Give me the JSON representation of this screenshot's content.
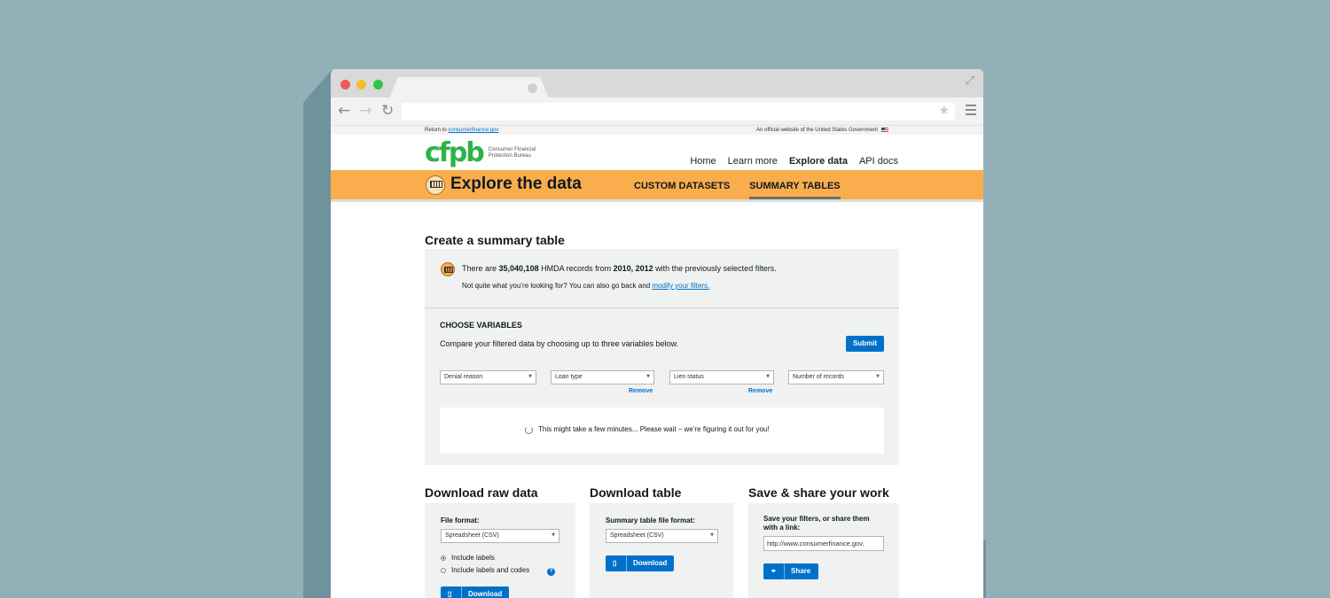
{
  "site": {
    "return_text": "Return to ",
    "return_link": "consumerfinance.gov",
    "official_text": "An official website of the United States Government",
    "logo_mark": "cfpb",
    "logo_text": "Consumer Financial Protection Bureau"
  },
  "nav": {
    "items": [
      {
        "label": "Home"
      },
      {
        "label": "Learn more"
      },
      {
        "label": "Explore data"
      },
      {
        "label": "API docs"
      }
    ]
  },
  "explore": {
    "title": "Explore the data",
    "tabs": [
      {
        "label": "CUSTOM DATASETS"
      },
      {
        "label": "SUMMARY TABLES"
      }
    ]
  },
  "summary": {
    "heading": "Create a summary table",
    "records_pre": "There are ",
    "records_count": "35,040,108",
    "records_mid": " HMDA records from ",
    "records_years": "2010, 2012",
    "records_post": " with the previously selected filters.",
    "sub_text": "Not quite what you’re looking for? You can also go back and ",
    "sub_link": "modify your filters.",
    "choose_title": "CHOOSE VARIABLES",
    "choose_desc": "Compare your filtered data by choosing up to three variables below.",
    "submit_label": "Submit",
    "selects": [
      "Denial reason",
      "Loan type",
      "Lien status",
      "Number of records"
    ],
    "remove_label": "Remove",
    "wait_text": "This might take a few minutes... Please wait – we’re figuring it out for you!"
  },
  "download_raw": {
    "title": "Download raw data",
    "file_format_label": "File format:",
    "format_value": "Spreadsheet (CSV)",
    "option_labels": "Include labels",
    "option_codes": "Include labels and codes",
    "button_label": "Download"
  },
  "download_table": {
    "title": "Download table",
    "format_label": "Summary table file format:",
    "format_value": "Spreadsheet (CSV)",
    "button_label": "Download"
  },
  "share": {
    "title": "Save & share your work",
    "desc": "Save your filters, or share them with a link:",
    "url_value": "http://www.consumerfinance.gov.",
    "button_label": "Share"
  }
}
